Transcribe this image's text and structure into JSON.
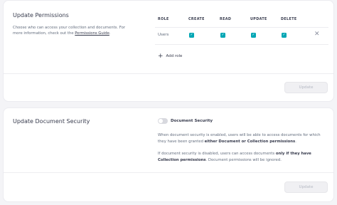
{
  "permissions": {
    "title": "Update Permissions",
    "description_prefix": "Choose who can access your collection and documents. For more information, check out the ",
    "description_link": "Permissions Guide",
    "description_suffix": ".",
    "columns": [
      "ROLE",
      "CREATE",
      "READ",
      "UPDATE",
      "DELETE"
    ],
    "rows": [
      {
        "role": "Users",
        "create": true,
        "read": true,
        "update": true,
        "delete": true
      }
    ],
    "add_role_label": "Add role",
    "update_button": "Update"
  },
  "security": {
    "title": "Update Document Security",
    "toggle_label": "Document Security",
    "toggle_on": false,
    "para1_prefix": "When document security is enabled, users will be able to access documents for which they have been granted ",
    "para1_bold": "either Document or Collection permissions",
    "para1_suffix": ".",
    "para2_prefix": "If document security is disabled, users can access documents ",
    "para2_bold": "only if they have Collection permissions",
    "para2_suffix": ". Document permissions will be ignored.",
    "update_button": "Update"
  },
  "colors": {
    "accent": "#00a6b4",
    "background": "#f4f4f7",
    "card": "#ffffff"
  },
  "icons": {
    "checkbox": "check-icon",
    "remove": "close-icon",
    "add": "plus-icon"
  }
}
